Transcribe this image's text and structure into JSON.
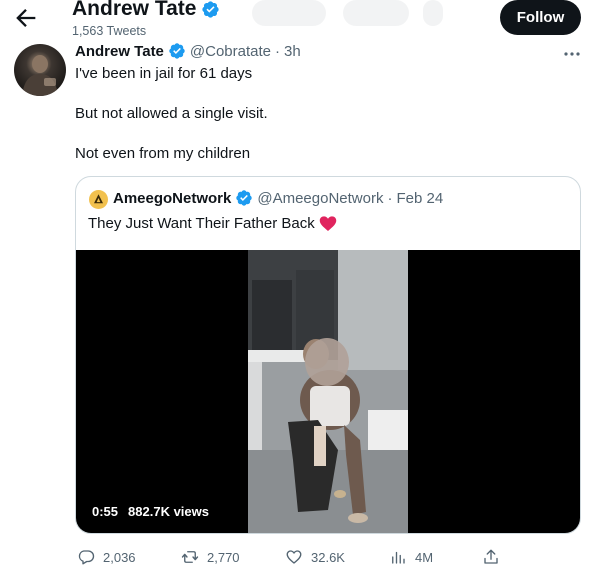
{
  "header": {
    "title": "Andrew Tate",
    "tweet_count": "1,563 Tweets",
    "follow_label": "Follow"
  },
  "tweet": {
    "author_name": "Andrew Tate",
    "handle": "@Cobratate",
    "separator": "·",
    "time": "3h",
    "lines": [
      "I've been in jail for 61 days",
      "But not allowed a single visit.",
      "Not even from my children"
    ]
  },
  "quote": {
    "author_name": "AmeegoNetwork",
    "handle": "@AmeegoNetwork",
    "separator": "·",
    "date": "Feb 24",
    "text": "They Just Want Their Father Back",
    "video": {
      "duration": "0:55",
      "views": "882.7K views"
    }
  },
  "actions": {
    "replies": "2,036",
    "retweets": "2,770",
    "likes": "32.6K",
    "views": "4M"
  },
  "icons": {
    "back": "arrow-left-icon",
    "verified": "verified-badge-icon",
    "more": "more-icon",
    "heart": "heart-icon",
    "reply": "reply-icon",
    "retweet": "retweet-icon",
    "like": "like-icon",
    "analytics": "analytics-icon",
    "share": "share-icon"
  },
  "colors": {
    "verified": "#1d9bf0",
    "text": "#0f1419",
    "muted": "#536471",
    "heart": "#e0245e",
    "follow_bg": "#0f1419"
  }
}
